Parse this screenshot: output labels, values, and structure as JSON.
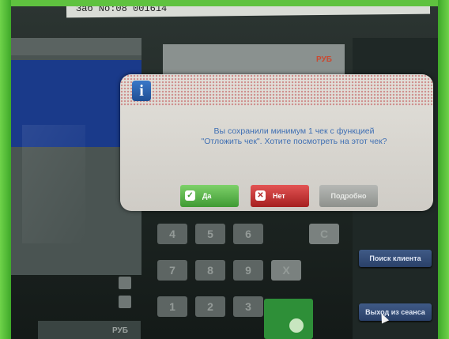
{
  "receipt_header": "Заб No:08 001614",
  "top_panel": {
    "currency_label": "РУБ"
  },
  "dialog": {
    "icon": "info-icon",
    "message_line1": "Вы сохранили минимум 1 чек с функцией",
    "message_line2": "\"Отложить чек\". Хотите посмотреть на этот чек?",
    "buttons": {
      "yes": "Да",
      "no": "Нет",
      "details": "Подробно"
    }
  },
  "keypad": {
    "keys": [
      "4",
      "5",
      "6",
      "C",
      "7",
      "8",
      "9",
      "X",
      "1",
      "2",
      "3"
    ]
  },
  "sidebar": {
    "search_client": "Поиск клиента",
    "exit_session": "Выход из сеанса"
  },
  "bottom_total": {
    "currency_label": "РУБ"
  },
  "colors": {
    "frame_green": "#5fc23f",
    "dialog_text": "#3f6fb3",
    "yes_green": "#3f9a33",
    "no_red": "#a51f1f"
  }
}
